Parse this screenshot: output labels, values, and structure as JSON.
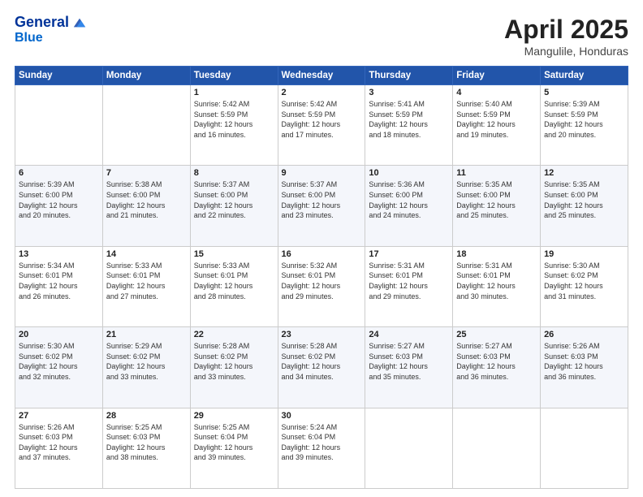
{
  "header": {
    "logo_line1": "General",
    "logo_line2": "Blue",
    "month": "April 2025",
    "location": "Mangulile, Honduras"
  },
  "weekdays": [
    "Sunday",
    "Monday",
    "Tuesday",
    "Wednesday",
    "Thursday",
    "Friday",
    "Saturday"
  ],
  "weeks": [
    [
      {
        "day": "",
        "info": ""
      },
      {
        "day": "",
        "info": ""
      },
      {
        "day": "1",
        "info": "Sunrise: 5:42 AM\nSunset: 5:59 PM\nDaylight: 12 hours\nand 16 minutes."
      },
      {
        "day": "2",
        "info": "Sunrise: 5:42 AM\nSunset: 5:59 PM\nDaylight: 12 hours\nand 17 minutes."
      },
      {
        "day": "3",
        "info": "Sunrise: 5:41 AM\nSunset: 5:59 PM\nDaylight: 12 hours\nand 18 minutes."
      },
      {
        "day": "4",
        "info": "Sunrise: 5:40 AM\nSunset: 5:59 PM\nDaylight: 12 hours\nand 19 minutes."
      },
      {
        "day": "5",
        "info": "Sunrise: 5:39 AM\nSunset: 5:59 PM\nDaylight: 12 hours\nand 20 minutes."
      }
    ],
    [
      {
        "day": "6",
        "info": "Sunrise: 5:39 AM\nSunset: 6:00 PM\nDaylight: 12 hours\nand 20 minutes."
      },
      {
        "day": "7",
        "info": "Sunrise: 5:38 AM\nSunset: 6:00 PM\nDaylight: 12 hours\nand 21 minutes."
      },
      {
        "day": "8",
        "info": "Sunrise: 5:37 AM\nSunset: 6:00 PM\nDaylight: 12 hours\nand 22 minutes."
      },
      {
        "day": "9",
        "info": "Sunrise: 5:37 AM\nSunset: 6:00 PM\nDaylight: 12 hours\nand 23 minutes."
      },
      {
        "day": "10",
        "info": "Sunrise: 5:36 AM\nSunset: 6:00 PM\nDaylight: 12 hours\nand 24 minutes."
      },
      {
        "day": "11",
        "info": "Sunrise: 5:35 AM\nSunset: 6:00 PM\nDaylight: 12 hours\nand 25 minutes."
      },
      {
        "day": "12",
        "info": "Sunrise: 5:35 AM\nSunset: 6:00 PM\nDaylight: 12 hours\nand 25 minutes."
      }
    ],
    [
      {
        "day": "13",
        "info": "Sunrise: 5:34 AM\nSunset: 6:01 PM\nDaylight: 12 hours\nand 26 minutes."
      },
      {
        "day": "14",
        "info": "Sunrise: 5:33 AM\nSunset: 6:01 PM\nDaylight: 12 hours\nand 27 minutes."
      },
      {
        "day": "15",
        "info": "Sunrise: 5:33 AM\nSunset: 6:01 PM\nDaylight: 12 hours\nand 28 minutes."
      },
      {
        "day": "16",
        "info": "Sunrise: 5:32 AM\nSunset: 6:01 PM\nDaylight: 12 hours\nand 29 minutes."
      },
      {
        "day": "17",
        "info": "Sunrise: 5:31 AM\nSunset: 6:01 PM\nDaylight: 12 hours\nand 29 minutes."
      },
      {
        "day": "18",
        "info": "Sunrise: 5:31 AM\nSunset: 6:01 PM\nDaylight: 12 hours\nand 30 minutes."
      },
      {
        "day": "19",
        "info": "Sunrise: 5:30 AM\nSunset: 6:02 PM\nDaylight: 12 hours\nand 31 minutes."
      }
    ],
    [
      {
        "day": "20",
        "info": "Sunrise: 5:30 AM\nSunset: 6:02 PM\nDaylight: 12 hours\nand 32 minutes."
      },
      {
        "day": "21",
        "info": "Sunrise: 5:29 AM\nSunset: 6:02 PM\nDaylight: 12 hours\nand 33 minutes."
      },
      {
        "day": "22",
        "info": "Sunrise: 5:28 AM\nSunset: 6:02 PM\nDaylight: 12 hours\nand 33 minutes."
      },
      {
        "day": "23",
        "info": "Sunrise: 5:28 AM\nSunset: 6:02 PM\nDaylight: 12 hours\nand 34 minutes."
      },
      {
        "day": "24",
        "info": "Sunrise: 5:27 AM\nSunset: 6:03 PM\nDaylight: 12 hours\nand 35 minutes."
      },
      {
        "day": "25",
        "info": "Sunrise: 5:27 AM\nSunset: 6:03 PM\nDaylight: 12 hours\nand 36 minutes."
      },
      {
        "day": "26",
        "info": "Sunrise: 5:26 AM\nSunset: 6:03 PM\nDaylight: 12 hours\nand 36 minutes."
      }
    ],
    [
      {
        "day": "27",
        "info": "Sunrise: 5:26 AM\nSunset: 6:03 PM\nDaylight: 12 hours\nand 37 minutes."
      },
      {
        "day": "28",
        "info": "Sunrise: 5:25 AM\nSunset: 6:03 PM\nDaylight: 12 hours\nand 38 minutes."
      },
      {
        "day": "29",
        "info": "Sunrise: 5:25 AM\nSunset: 6:04 PM\nDaylight: 12 hours\nand 39 minutes."
      },
      {
        "day": "30",
        "info": "Sunrise: 5:24 AM\nSunset: 6:04 PM\nDaylight: 12 hours\nand 39 minutes."
      },
      {
        "day": "",
        "info": ""
      },
      {
        "day": "",
        "info": ""
      },
      {
        "day": "",
        "info": ""
      }
    ]
  ]
}
